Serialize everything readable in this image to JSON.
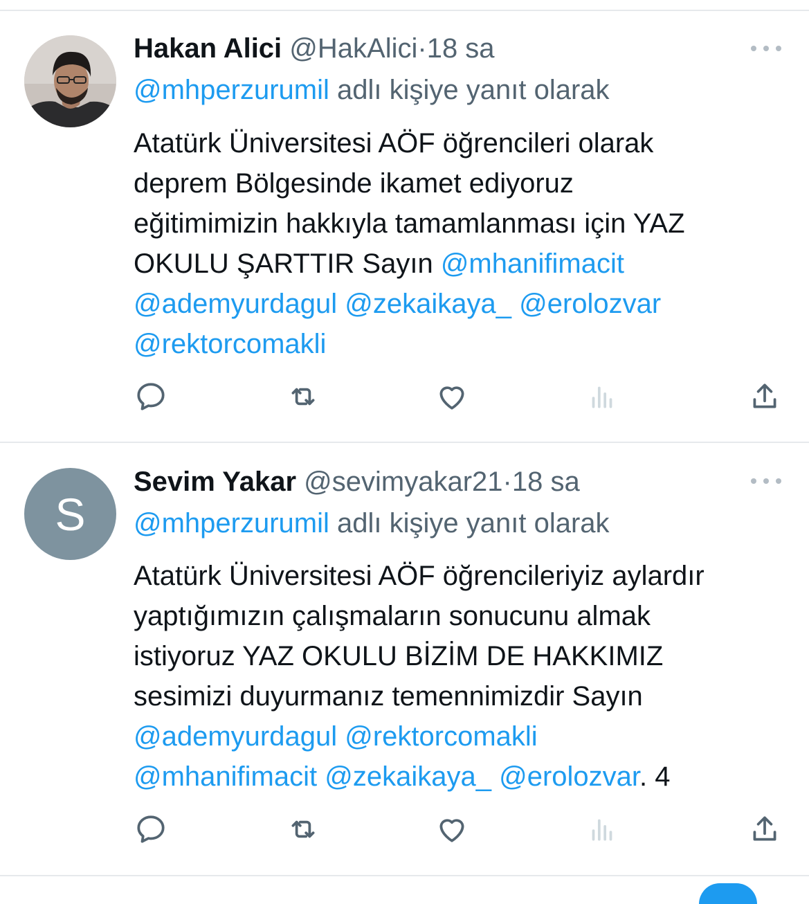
{
  "tweets": [
    {
      "name": "Hakan Alici",
      "handle": "@HakAlici",
      "separator": "·",
      "time": "18 sa",
      "reply_to": {
        "mention": "@mhperzurumil",
        "suffix": " adlı kişiye yanıt olarak"
      },
      "body": [
        {
          "text": "Atatürk Üniversitesi AÖF öğrencileri olarak"
        },
        {
          "text": "deprem Bölgesinde ikamet ediyoruz"
        },
        {
          "text": "eğitimimizin hakkıyla tamamlanması için YAZ"
        },
        {
          "text": "OKULU ŞARTTIR Sayın ",
          "mention": "@mhanifimacit"
        },
        {
          "mention": "@ademyurdagul",
          "text2": " ",
          "mention2": "@zekaikaya_",
          "text3": " ",
          "mention3": "@erolozvar"
        },
        {
          "mention": "@rektorcomakli"
        }
      ],
      "avatar": {
        "type": "photo",
        "icon": "user-photo"
      }
    },
    {
      "name": "Sevim Yakar",
      "handle": "@sevimyakar21",
      "separator": "·",
      "time": "18 sa",
      "reply_to": {
        "mention": "@mhperzurumil",
        "suffix": " adlı kişiye yanıt olarak"
      },
      "body": [
        {
          "text": "Atatürk Üniversitesi AÖF öğrencileriyiz aylardır"
        },
        {
          "text": "yaptığımızın çalışmaların sonucunu almak"
        },
        {
          "text": "istiyoruz YAZ OKULU BİZİM DE HAKKIMIZ"
        },
        {
          "text": "sesimizi duyurmanız temennimizdir Sayın"
        },
        {
          "mention": "@ademyurdagul",
          "text2": " ",
          "mention2": "@rektorcomakli"
        },
        {
          "mention": "@mhanifimacit",
          "text2": " ",
          "mention2": "@zekaikaya_",
          "text3": " ",
          "mention3": "@erolozvar",
          "text4": ". 4"
        }
      ],
      "avatar": {
        "type": "letter",
        "letter": "S",
        "color": "#7e939f"
      }
    }
  ],
  "actions": [
    "reply-icon",
    "retweet-icon",
    "like-icon",
    "views-icon",
    "share-icon"
  ],
  "colors": {
    "mention": "#1d9bf0",
    "secondary": "#536471",
    "icon": "#536471",
    "views_icon_disabled": "#cfd9de"
  }
}
